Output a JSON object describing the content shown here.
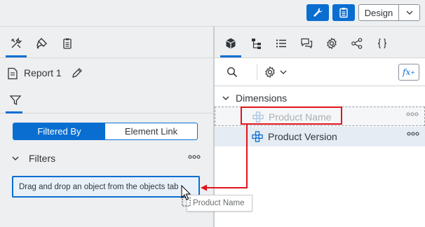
{
  "topbar": {
    "tools_icon": "wrench-icon",
    "clipboard_icon": "clipboard-icon",
    "mode_label": "Design",
    "mode_dropdown_icon": "chevron-down-icon"
  },
  "left_panel": {
    "tabs": [
      {
        "icon": "tools-icon",
        "active": true
      },
      {
        "icon": "paint-icon",
        "active": false
      },
      {
        "icon": "clipboard-icon",
        "active": false
      }
    ],
    "report_name": "Report 1",
    "filter_tab_icon": "funnel-icon",
    "segmented": [
      "Filtered By",
      "Element Link"
    ],
    "segmented_selected": "Filtered By",
    "filters_label": "Filters",
    "dropzone_text": "Drag and drop an object from the objects tab",
    "drag_ghost_label": "Product Name"
  },
  "right_panel": {
    "tabs": [
      {
        "icon": "cube-icon",
        "active": true
      },
      {
        "icon": "hierarchy-icon",
        "active": false
      },
      {
        "icon": "list-icon",
        "active": false
      },
      {
        "icon": "comments-icon",
        "active": false
      },
      {
        "icon": "settings-icon",
        "active": false
      },
      {
        "icon": "share-icon",
        "active": false
      },
      {
        "icon": "braces-icon",
        "active": false
      }
    ],
    "fx_label": "fx",
    "fx_sup": "+",
    "section_label": "Dimensions",
    "items": [
      {
        "label": "Product Name",
        "state": "dragging"
      },
      {
        "label": "Product Version",
        "state": "normal"
      }
    ]
  },
  "colors": {
    "accent": "#0a6ed1",
    "annotation": "#e0141e"
  }
}
